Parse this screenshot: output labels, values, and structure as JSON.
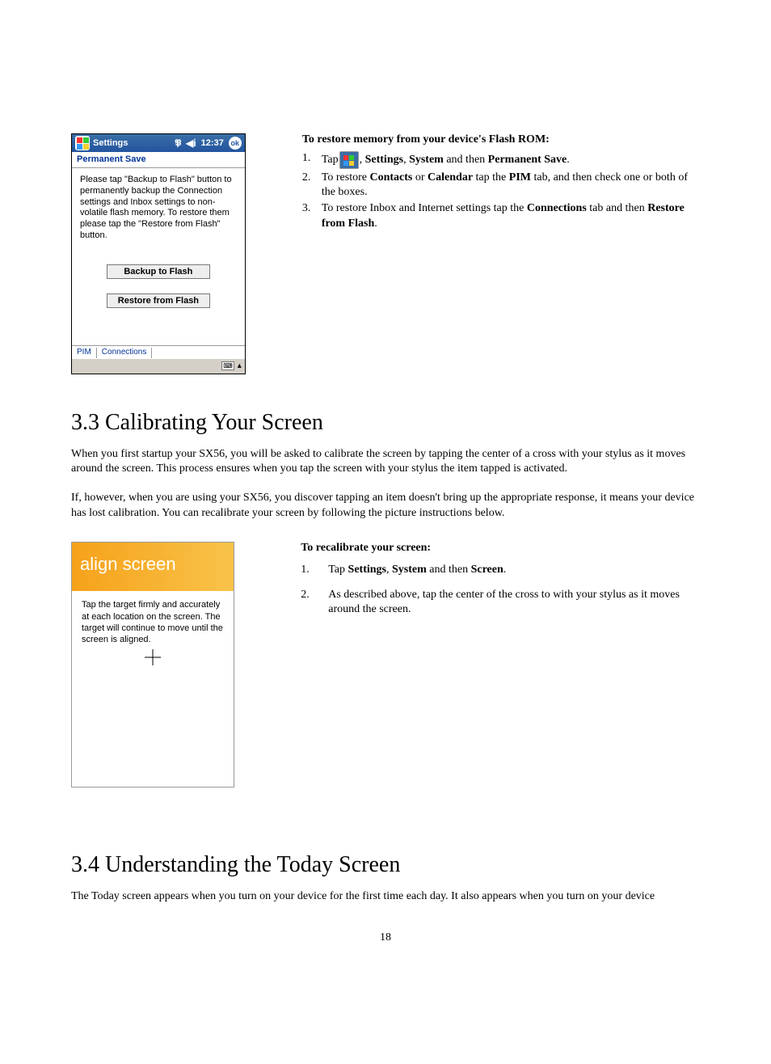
{
  "shot1": {
    "titlebar": {
      "app": "Settings",
      "time": "12:37",
      "ok": "ok"
    },
    "subheader": "Permanent Save",
    "body": "Please tap \"Backup to Flash\" button to permanently backup the Connection settings and Inbox settings to non-volatile flash memory. To restore them please tap the \"Restore from Flash\" button.",
    "btn_backup": "Backup to Flash",
    "btn_restore": "Restore from Flash",
    "tabs": {
      "pim": "PIM",
      "conn": "Connections"
    }
  },
  "instr1": {
    "title": "To restore memory from your device's Flash ROM:",
    "items": [
      {
        "num": "1.",
        "pre": "Tap",
        "post": ", ",
        "b1": "Settings",
        "mid1": ", ",
        "b2": "System",
        "mid2": " and then ",
        "b3": "Permanent Save",
        "end": "."
      },
      {
        "num": "2.",
        "text_a": "To restore ",
        "b1": "Contacts",
        "mid1": " or ",
        "b2": "Calendar",
        "mid2": " tap the ",
        "b3": "PIM",
        "text_b": " tab, and then check one or both of the boxes."
      },
      {
        "num": "3.",
        "text_a": "To restore Inbox and Internet settings tap the ",
        "b1": "Connections",
        "mid1": " tab and then ",
        "b2": "Restore from Flash",
        "end": "."
      }
    ]
  },
  "sec33": {
    "heading": "3.3 Calibrating Your Screen",
    "p1": "When you first startup your SX56, you will be asked to calibrate the screen by tapping the center of a cross with your stylus as it moves around the screen. This process ensures when you tap the screen with your stylus the item tapped is activated.",
    "p2": "If, however, when you are using your SX56, you discover tapping an item doesn't bring up the appropriate response, it means your device has lost calibration.  You can recalibrate your screen by following the picture instructions below."
  },
  "shot2": {
    "header": "align screen",
    "body": "Tap the target firmly and accurately at each location on the screen. The target will continue to move until the screen is aligned."
  },
  "instr2": {
    "title": "To recalibrate your screen:",
    "items": [
      {
        "num": "1.",
        "text_a": "Tap ",
        "b1": "Settings",
        "mid1": ", ",
        "b2": "System",
        "mid2": " and then ",
        "b3": "Screen",
        "end": "."
      },
      {
        "num": "2.",
        "text": "As described above, tap the center of the cross to with your stylus as it moves around the screen."
      }
    ]
  },
  "sec34": {
    "heading": "3.4 Understanding the Today Screen",
    "p1": "The Today screen appears when you turn on your device for the first time each day.  It also appears when you turn on your device"
  },
  "page_number": "18"
}
